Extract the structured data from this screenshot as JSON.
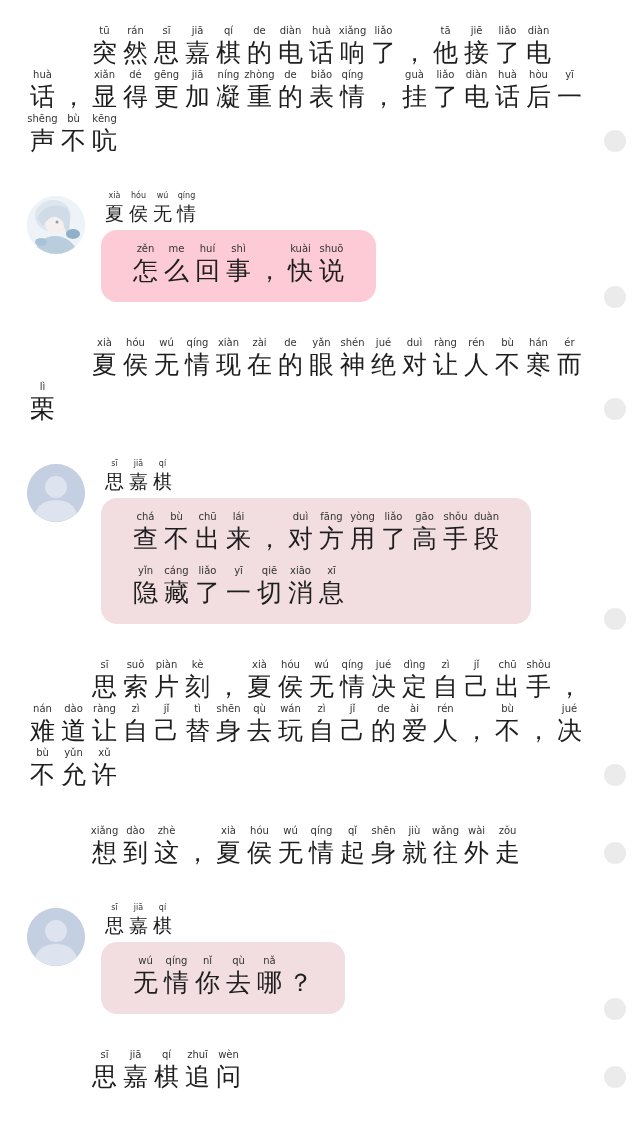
{
  "blocks": [
    {
      "kind": "narration",
      "lines": [
        {
          "text": "突然思嘉棋的电话响了，他接了电",
          "pinyin": "tū rán sī jiā qí de diàn huà xiǎng liǎo tā jiē liǎo diàn"
        },
        {
          "text": "话，显得更加凝重的表情，挂了电话后一",
          "pinyin": "huà xiǎn dé gēng jiā níng zhòng de biǎo qíng guà liǎo diàn huà hòu yī"
        },
        {
          "text": "声不吭",
          "pinyin": "shēng bù kēng"
        }
      ]
    },
    {
      "kind": "message",
      "speaker": {
        "text": "夏侯无情",
        "pinyin": "xià hóu wú qíng"
      },
      "avatar": {
        "kind": "picture"
      },
      "color": "#fccbd6",
      "lines": [
        {
          "text": "怎么回事，快说",
          "pinyin": "zěn me huí shì kuài shuō"
        }
      ]
    },
    {
      "kind": "narration",
      "lines": [
        {
          "text": "夏侯无情现在的眼神绝对让人不寒而",
          "pinyin": "xià hóu wú qíng xiàn zài de yǎn shén jué duì ràng rén bù hán ér"
        },
        {
          "text": "栗",
          "pinyin": "lì"
        }
      ]
    },
    {
      "kind": "message",
      "speaker": {
        "text": "思嘉棋",
        "pinyin": "sī jiā qí"
      },
      "avatar": {
        "kind": "default"
      },
      "color": "#f2dde0",
      "lines": [
        {
          "text": "查不出来，对方用了高手段",
          "pinyin": "chá bù chū lái duì fāng yòng liǎo gāo shǒu duàn"
        },
        {
          "text": "隐藏了一切消息",
          "pinyin": "yǐn cáng liǎo yī qiē xiāo xī"
        }
      ]
    },
    {
      "kind": "narration",
      "lines": [
        {
          "text": "思索片刻，夏侯无情决定自己出手，",
          "pinyin": "sī suǒ piàn kè xià hóu wú qíng jué dìng zì jǐ chū shǒu"
        },
        {
          "text": "难道让自己替身去玩自己的爱人，不，决",
          "pinyin": "nán dào ràng zì jǐ tì shēn qù wán zì jǐ de ài rén bù jué"
        },
        {
          "text": "不允许",
          "pinyin": "bù yǔn xǔ"
        }
      ]
    },
    {
      "kind": "narration",
      "lines": [
        {
          "text": "想到这，夏侯无情起身就往外走",
          "pinyin": "xiǎng dào zhè xià hóu wú qíng qǐ shēn jiù wǎng wài zǒu"
        }
      ]
    },
    {
      "kind": "message",
      "speaker": {
        "text": "思嘉棋",
        "pinyin": "sī jiā qí"
      },
      "avatar": {
        "kind": "default"
      },
      "color": "#f2dde0",
      "lines": [
        {
          "text": "无情你去哪？",
          "pinyin": "wú qíng nǐ qù nǎ"
        }
      ]
    },
    {
      "kind": "narration",
      "lines": [
        {
          "text": "思嘉棋追问",
          "pinyin": "sī jiā qí zhuī wèn"
        }
      ]
    }
  ]
}
